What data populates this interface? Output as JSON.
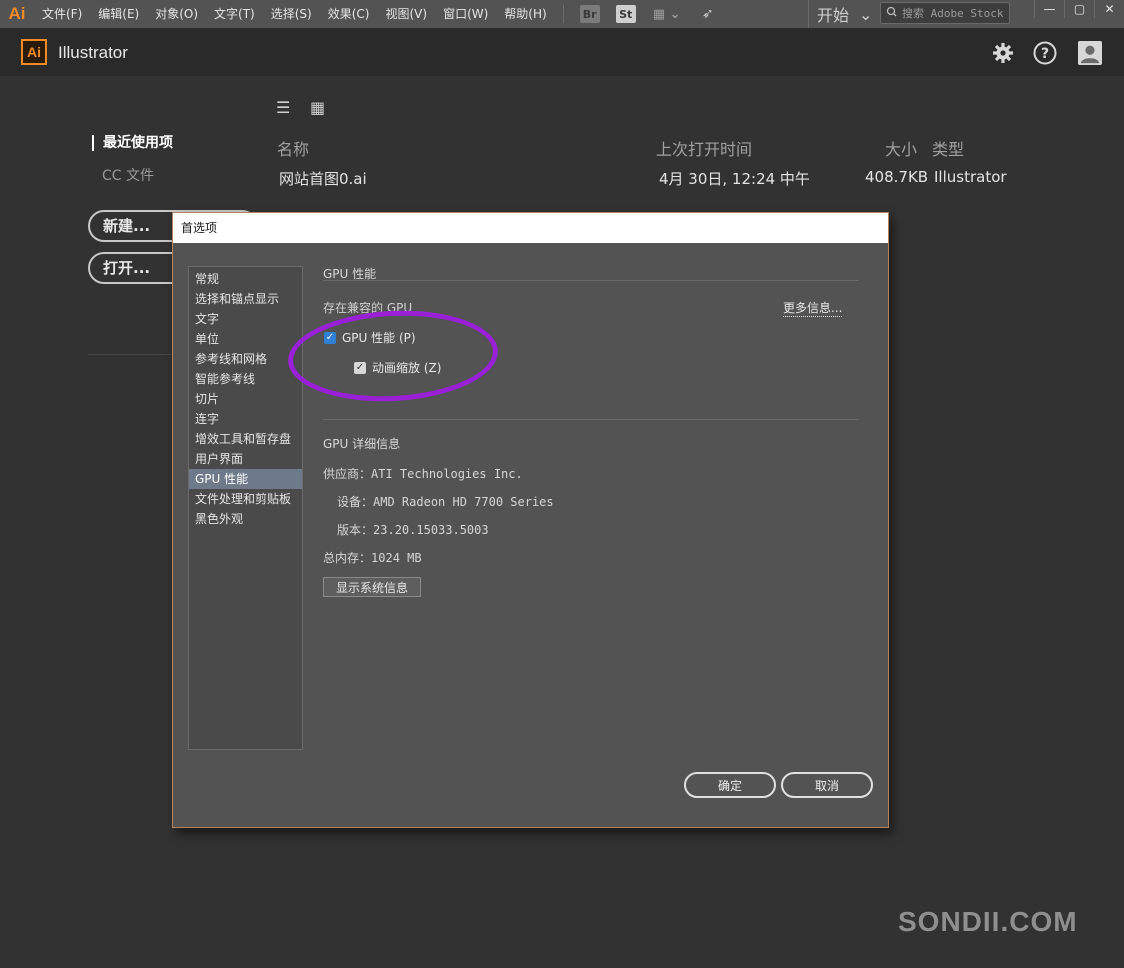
{
  "menubar": {
    "logo": "Ai",
    "items": [
      "文件(F)",
      "编辑(E)",
      "对象(O)",
      "文字(T)",
      "选择(S)",
      "效果(C)",
      "视图(V)",
      "窗口(W)",
      "帮助(H)"
    ],
    "bridge": "Br",
    "stock": "St",
    "workspace": "开始",
    "search_placeholder": "搜索 Adobe Stock"
  },
  "app": {
    "logo": "Ai",
    "title": "Illustrator"
  },
  "home": {
    "nav_recent": "最近使用项",
    "nav_cc": "CC 文件",
    "new_label": "新建...",
    "open_label": "打开...",
    "columns": {
      "name": "名称",
      "last_opened": "上次打开时间",
      "size": "大小",
      "type": "类型"
    },
    "files": [
      {
        "name": "网站首图0.ai",
        "last_opened": "4月 30日, 12:24 中午",
        "size": "408.7KB",
        "type": "Illustrator"
      }
    ]
  },
  "dialog": {
    "title": "首选项",
    "categories": [
      "常规",
      "选择和锚点显示",
      "文字",
      "单位",
      "参考线和网格",
      "智能参考线",
      "切片",
      "连字",
      "增效工具和暂存盘",
      "用户界面",
      "GPU 性能",
      "文件处理和剪贴板",
      "黑色外观"
    ],
    "active_category": "GPU 性能",
    "section_title": "GPU 性能",
    "compat_text": "存在兼容的 GPU",
    "more_info": "更多信息...",
    "gpu_perf_label": "GPU 性能 (P)",
    "anim_zoom_label": "动画缩放 (Z)",
    "details_title": "GPU 详细信息",
    "vendor_label": "供应商：",
    "vendor": "ATI Technologies Inc.",
    "device_label": "设备：",
    "device": "AMD Radeon HD 7700 Series",
    "version_label": "版本：",
    "version": "23.20.15033.5003",
    "memory_label": "总内存：",
    "memory": "1024 MB",
    "sys_info_button": "显示系统信息",
    "ok_button": "确定",
    "cancel_button": "取消"
  },
  "watermark": "SONDII.COM"
}
